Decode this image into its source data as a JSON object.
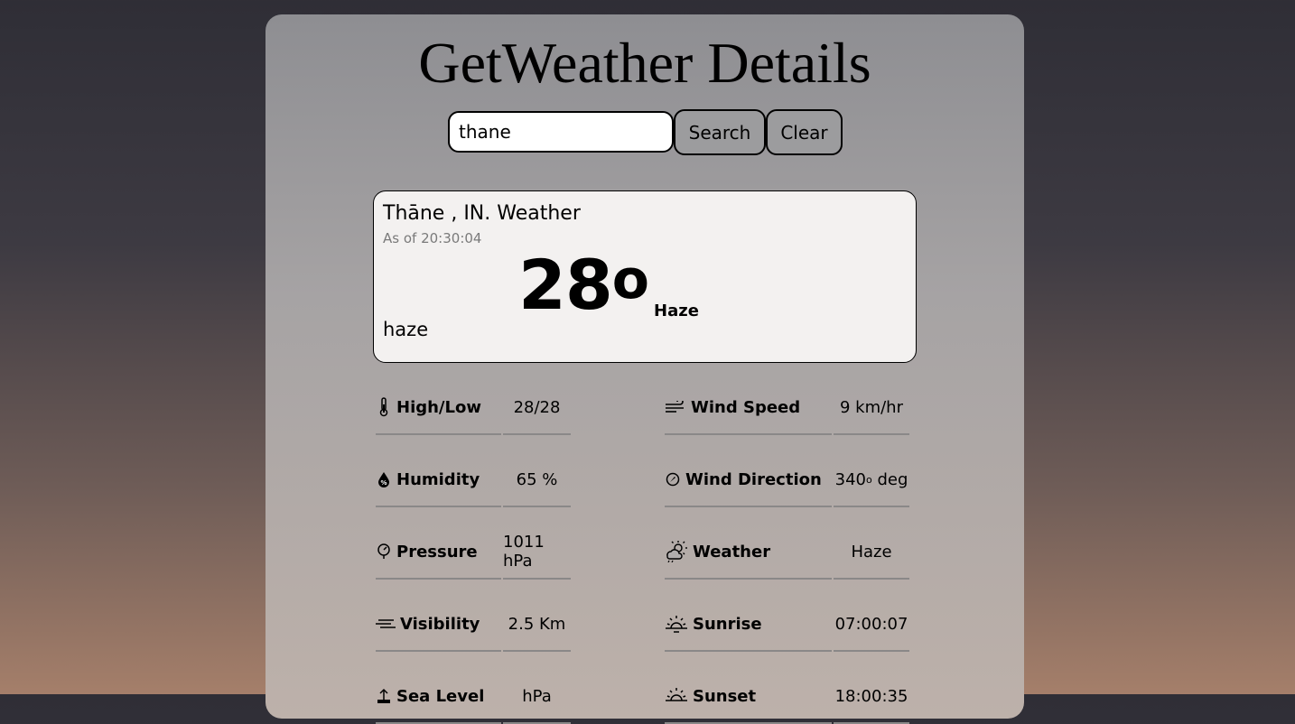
{
  "app": {
    "title": "GetWeather Details"
  },
  "search": {
    "value": "thane",
    "search_label": "Search",
    "clear_label": "Clear"
  },
  "current": {
    "location": "Thāne , IN. Weather",
    "as_of_label": "As of",
    "as_of_time": "20:30:04",
    "temperature": "28",
    "degree_symbol": "o",
    "condition": "Haze",
    "description": "haze"
  },
  "details": {
    "high_low": {
      "label": "High/Low",
      "value": "28/28",
      "icon": "thermometer-icon"
    },
    "wind_speed": {
      "label": "Wind Speed",
      "value": "9 km/hr",
      "icon": "wind-icon"
    },
    "humidity": {
      "label": "Humidity",
      "value": "65 %",
      "icon": "droplet-percent-icon"
    },
    "wind_direction": {
      "label": "Wind Direction",
      "value_num": "340",
      "value_sup": "o",
      "value_unit": " deg",
      "icon": "compass-icon"
    },
    "pressure": {
      "label": "Pressure",
      "value": "1011 hPa",
      "icon": "gauge-icon"
    },
    "weather": {
      "label": "Weather",
      "value": "Haze",
      "icon": "sun-cloud-icon"
    },
    "visibility": {
      "label": "Visibility",
      "value": "2.5 Km",
      "icon": "fog-icon"
    },
    "sunrise": {
      "label": "Sunrise",
      "value": "07:00:07",
      "icon": "sunrise-icon"
    },
    "sea_level": {
      "label": "Sea Level",
      "value": "hPa",
      "icon": "sea-level-icon"
    },
    "sunset": {
      "label": "Sunset",
      "value": "18:00:35",
      "icon": "sunset-icon"
    }
  }
}
